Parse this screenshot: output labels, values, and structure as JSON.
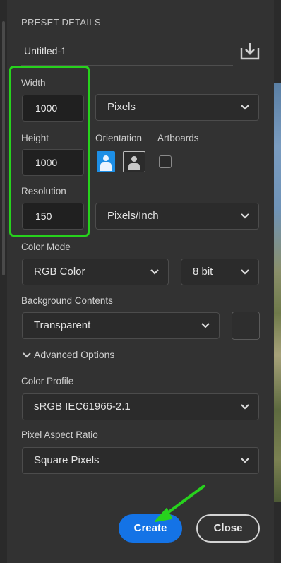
{
  "panel": {
    "section_title": "PRESET DETAILS",
    "preset_name": "Untitled-1",
    "save_preset_icon": "save-preset-icon"
  },
  "width": {
    "label": "Width",
    "value": "1000",
    "unit": "Pixels"
  },
  "height": {
    "label": "Height",
    "value": "1000"
  },
  "orientation": {
    "label": "Orientation",
    "selected": "portrait"
  },
  "artboards": {
    "label": "Artboards",
    "checked": false
  },
  "resolution": {
    "label": "Resolution",
    "value": "150",
    "unit": "Pixels/Inch"
  },
  "color_mode": {
    "label": "Color Mode",
    "value": "RGB Color",
    "bit_depth": "8 bit"
  },
  "background": {
    "label": "Background Contents",
    "value": "Transparent"
  },
  "advanced": {
    "label": "Advanced Options"
  },
  "color_profile": {
    "label": "Color Profile",
    "value": "sRGB IEC61966-2.1"
  },
  "pixel_aspect": {
    "label": "Pixel Aspect Ratio",
    "value": "Square Pixels"
  },
  "actions": {
    "create_label": "Create",
    "close_label": "Close"
  },
  "colors": {
    "accent": "#1473e6",
    "highlight": "#27d21d",
    "panel_bg": "#323232"
  }
}
